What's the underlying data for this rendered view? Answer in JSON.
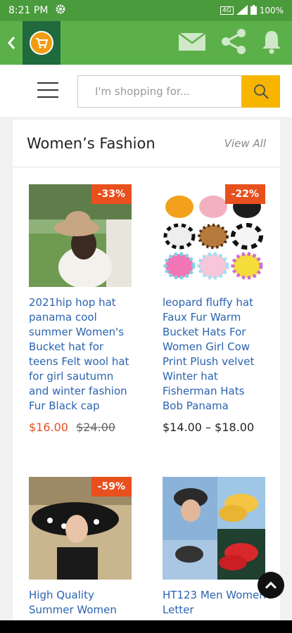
{
  "status": {
    "time": "8:21 PM",
    "battery": "100%",
    "signal": "4G"
  },
  "search": {
    "placeholder": "I'm shopping for..."
  },
  "section": {
    "title": "Women’s Fashion",
    "view_all": "View All"
  },
  "products": [
    {
      "badge": "-33%",
      "title": "2021hip hop hat panama cool summer Women's Bucket hat for teens Felt wool hat for girl sautumn and winter fashion Fur Black cap",
      "price_sale": "$16.00",
      "price_old": "$24.00"
    },
    {
      "badge": "-22%",
      "title": "leopard fluffy hat Faux Fur Warm Bucket Hats For Women Girl Cow Print Plush velvet Winter hat Fisherman Hats Bob Panama",
      "price_range": "$14.00 – $18.00"
    },
    {
      "badge": "-59%",
      "title": "High Quality Summer Women"
    },
    {
      "title": "HT123 Men Women Letter"
    }
  ]
}
